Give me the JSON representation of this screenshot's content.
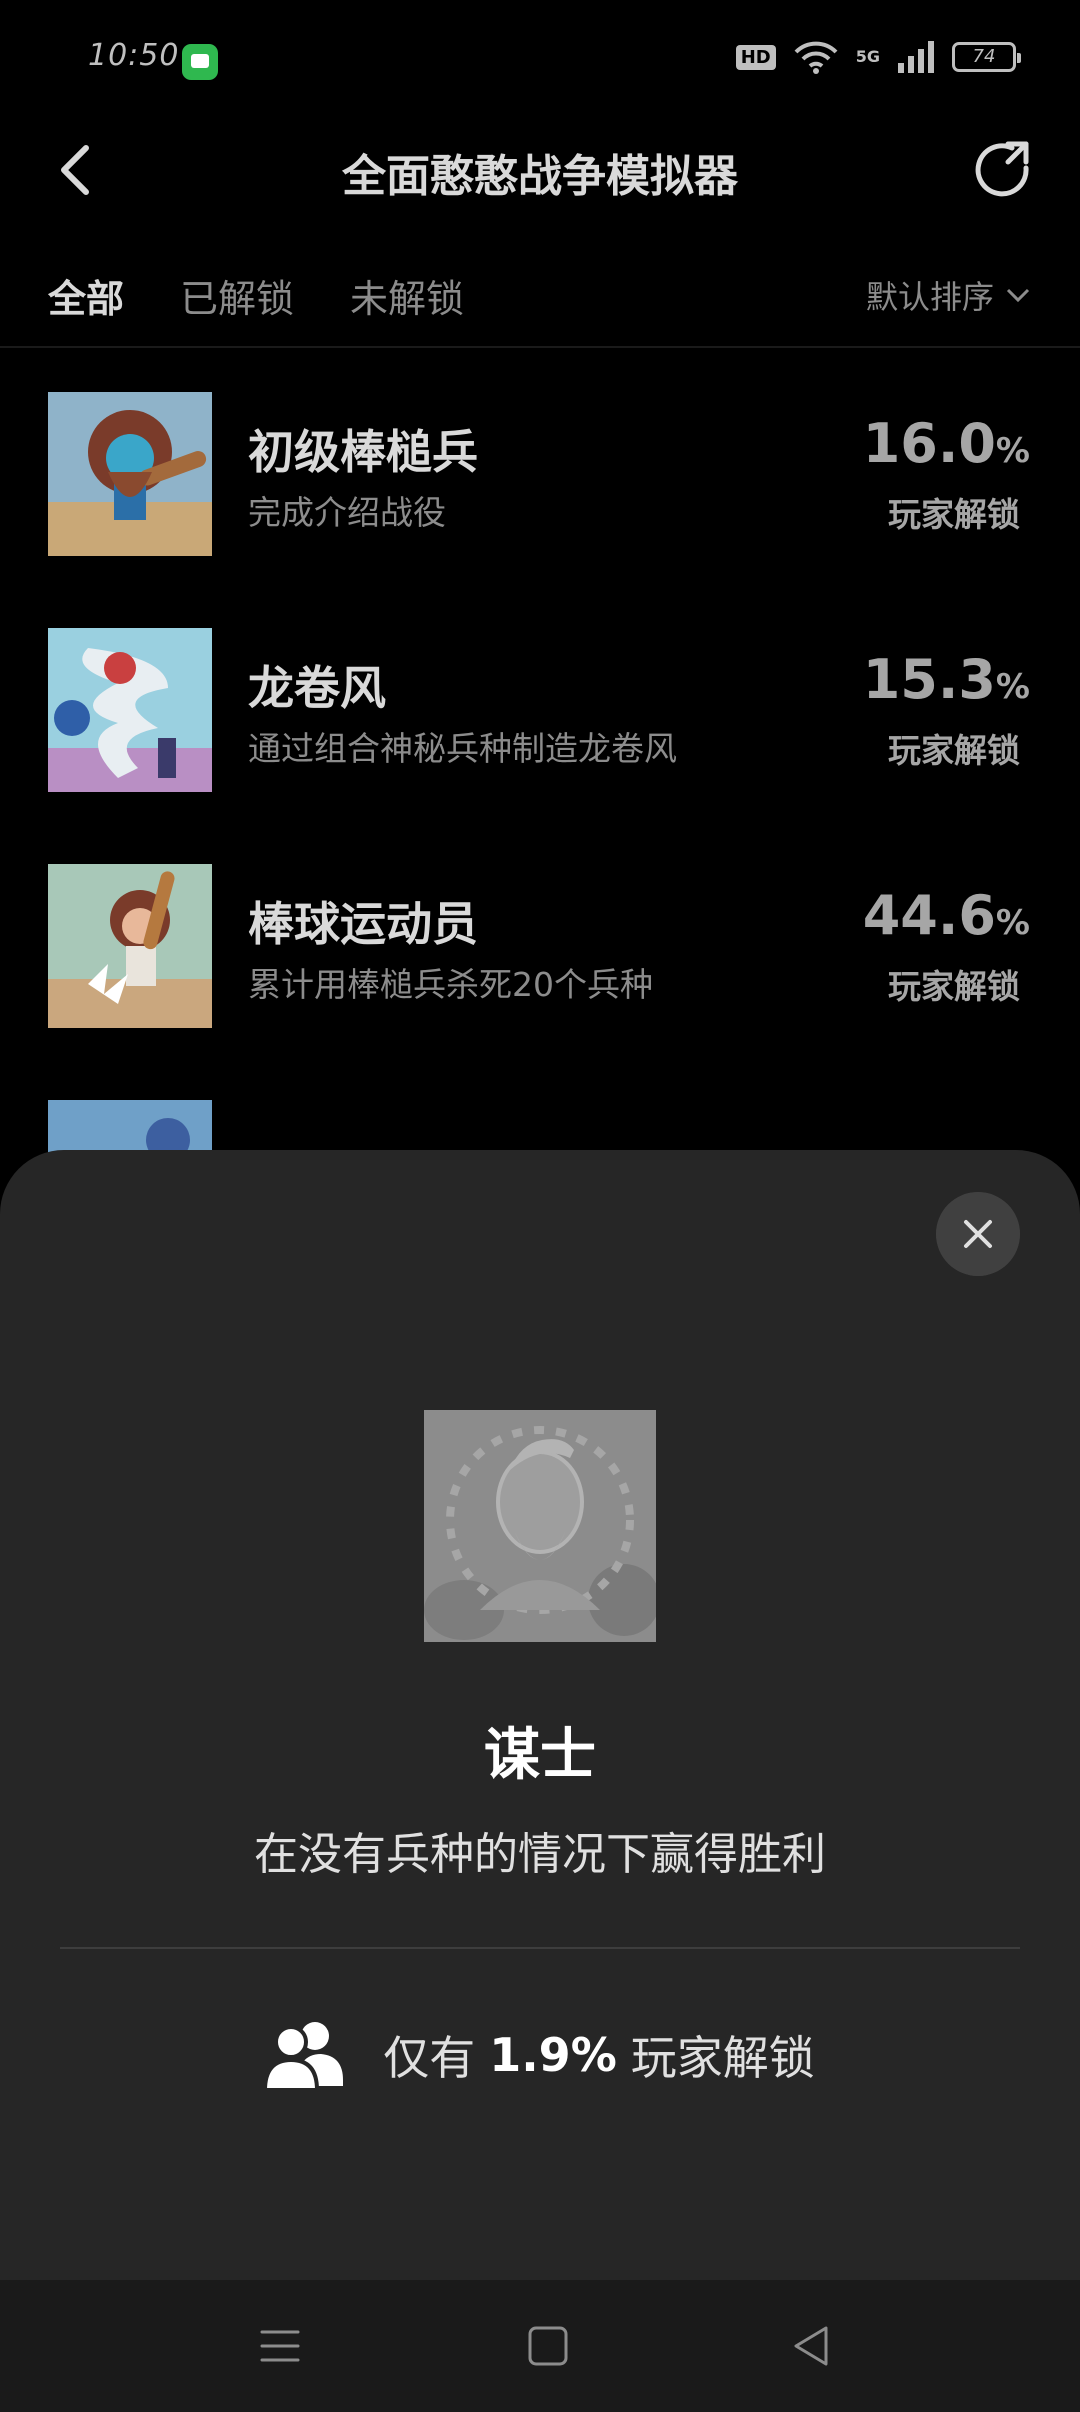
{
  "status_bar": {
    "time": "10:50",
    "hd": "HD",
    "network": "5G",
    "battery": "74"
  },
  "header": {
    "title": "全面憨憨战争模拟器"
  },
  "tabs": [
    {
      "label": "全部",
      "active": true
    },
    {
      "label": "已解锁",
      "active": false
    },
    {
      "label": "未解锁",
      "active": false
    }
  ],
  "sort": {
    "label": "默认排序"
  },
  "achievements": [
    {
      "name": "初级棒槌兵",
      "desc": "完成介绍战役",
      "percent": "16.0",
      "pct_sign": "%",
      "pct_label": "玩家解锁"
    },
    {
      "name": "龙卷风",
      "desc": "通过组合神秘兵种制造龙卷风",
      "percent": "15.3",
      "pct_sign": "%",
      "pct_label": "玩家解锁"
    },
    {
      "name": "棒球运动员",
      "desc": "累计用棒槌兵杀死20个兵种",
      "percent": "44.6",
      "pct_sign": "%",
      "pct_label": "玩家解锁"
    }
  ],
  "detail_sheet": {
    "title": "谋士",
    "desc": "在没有兵种的情况下赢得胜利",
    "stat_prefix": "仅有",
    "stat_percent": "1.9%",
    "stat_suffix": "玩家解锁"
  },
  "colors": {
    "background": "#000000",
    "sheet": "#262626",
    "nav_bar": "#1a1a1a"
  }
}
